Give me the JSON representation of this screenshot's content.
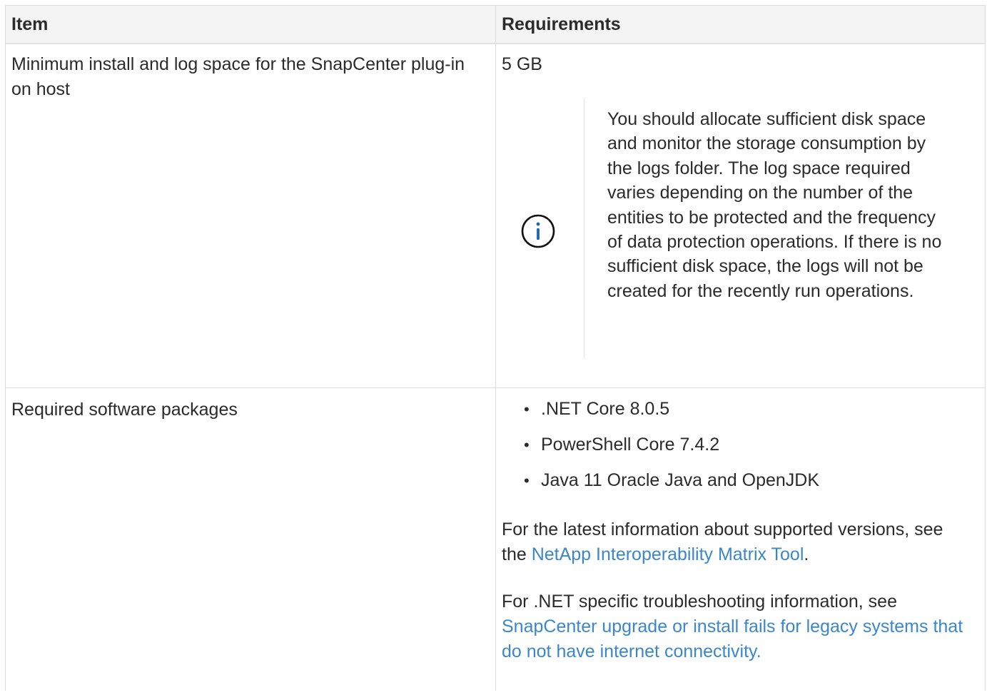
{
  "table": {
    "headers": {
      "item": "Item",
      "requirements": "Requirements"
    },
    "rows": [
      {
        "item": "Minimum install and log space for the SnapCenter plug-in on host",
        "value": "5 GB",
        "note": {
          "icon": "info-icon",
          "text": "You should allocate sufficient disk space and monitor the storage consumption by the logs folder. The log space required varies depending on the number of the entities to be protected and the frequency of data protection operations. If there is no sufficient disk space, the logs will not be created for the recently run operations."
        }
      },
      {
        "item": "Required software packages",
        "bullets": [
          ".NET Core 8.0.5",
          "PowerShell Core 7.4.2",
          "Java 11 Oracle Java and OpenJDK"
        ],
        "para1": {
          "prefix": "For the latest information about supported versions, see the ",
          "link": "NetApp Interoperability Matrix Tool",
          "suffix": "."
        },
        "para2": {
          "prefix": "For .NET specific troubleshooting information, see ",
          "link": "SnapCenter upgrade or install fails for legacy systems that do not have internet connectivity."
        }
      }
    ]
  },
  "colors": {
    "link": "#3b87c9",
    "icon": "#1a64b7",
    "header_bg": "#f4f4f4",
    "border": "#dcdcdc"
  }
}
